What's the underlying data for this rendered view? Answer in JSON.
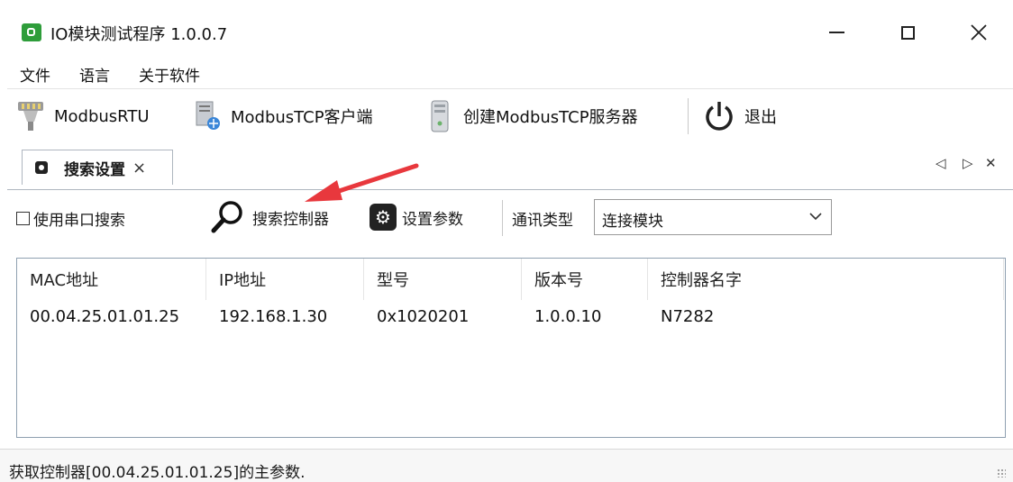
{
  "window": {
    "title": "IO模块测试程序 1.0.0.7"
  },
  "menu": {
    "items": [
      {
        "label": "文件"
      },
      {
        "label": "语言"
      },
      {
        "label": "关于软件"
      }
    ]
  },
  "toolbar": {
    "modbus_rtu": "ModbusRTU",
    "modbus_tcp_client": "ModbusTCP客户端",
    "create_tcp_server": "创建ModbusTCP服务器",
    "exit": "退出"
  },
  "tabs": [
    {
      "label": "搜索设置",
      "close": "×",
      "active": true
    }
  ],
  "tab_nav": {
    "left": "◁",
    "right": "▷",
    "close": "✕"
  },
  "search": {
    "use_serial_label": "使用串口搜索",
    "use_serial_checked": false,
    "search_button": "搜索控制器",
    "settings_button": "设置参数",
    "comm_type_label": "通讯类型",
    "comm_type_value": "连接模块"
  },
  "table": {
    "columns": [
      "MAC地址",
      "IP地址",
      "型号",
      "版本号",
      "控制器名字"
    ],
    "rows": [
      {
        "mac": "00.04.25.01.01.25",
        "ip": "192.168.1.30",
        "model": "0x1020201",
        "version": "1.0.0.10",
        "name": "N7282"
      }
    ]
  },
  "status": {
    "text": "获取控制器[00.04.25.01.01.25]的主参数."
  },
  "colors": {
    "app_icon": "#2e9d3a",
    "annotation_arrow": "#e8383d",
    "list_border": "#8fa0b0"
  }
}
